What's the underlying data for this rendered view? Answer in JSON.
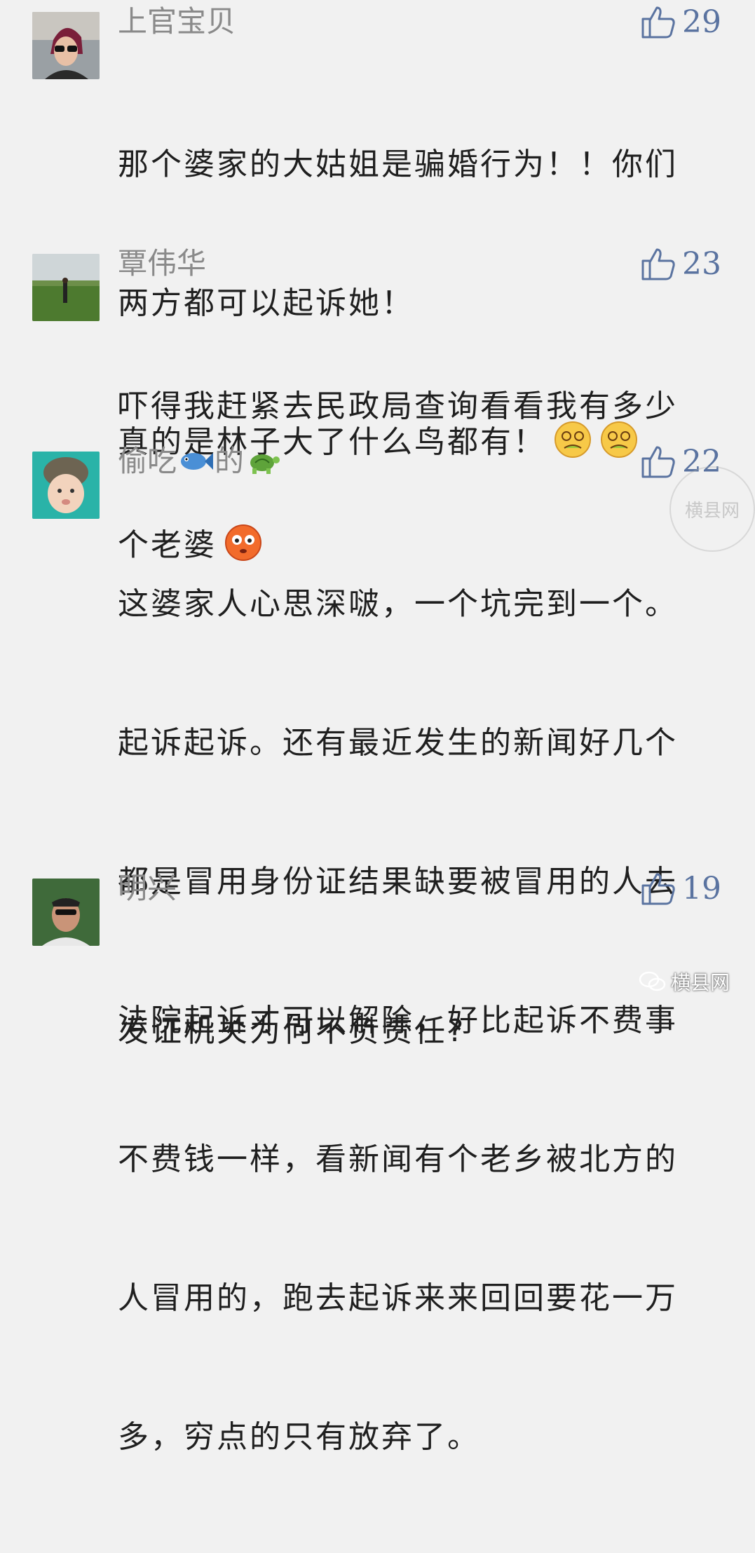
{
  "comments": [
    {
      "username": "上官宝贝",
      "likes": "29",
      "lines": [
        "那个婆家的大姑姐是骗婚行为！！你们",
        "两方都可以起诉她！",
        "真的是林子大了什么鸟都有！"
      ],
      "trailing_emojis": [
        "dizzy-sick-face-emoji",
        "dizzy-sick-face-emoji"
      ]
    },
    {
      "username": "覃伟华",
      "likes": "23",
      "lines": [
        "吓得我赶紧去民政局查询看看我有多少",
        "个老婆"
      ],
      "trailing_emojis": [
        "flushed-face-emoji"
      ]
    },
    {
      "username_parts": [
        "偷吃",
        "的"
      ],
      "username_emojis": [
        "fish-emoji",
        "turtle-emoji"
      ],
      "likes": "22",
      "lines": [
        "这婆家人心思深啵，一个坑完到一个。",
        "起诉起诉。还有最近发生的新闻好几个",
        "都是冒用身份证结果缺要被冒用的人去",
        "法院起诉才可以解除，好比起诉不费事",
        "不费钱一样，看新闻有个老乡被北方的",
        "人冒用的，跑去起诉来来回回要花一万",
        "多，穷点的只有放弃了。"
      ]
    },
    {
      "username": "明兴",
      "likes": "19",
      "lines": [
        "发证机关为何不负责任?"
      ]
    }
  ],
  "watermark": {
    "seal_text": "横县网",
    "footer_text": "横县网"
  },
  "colors": {
    "background": "#f1f1f1",
    "like": "#5a73a0",
    "username": "#8a8a8a",
    "text": "#1f1f1f"
  }
}
